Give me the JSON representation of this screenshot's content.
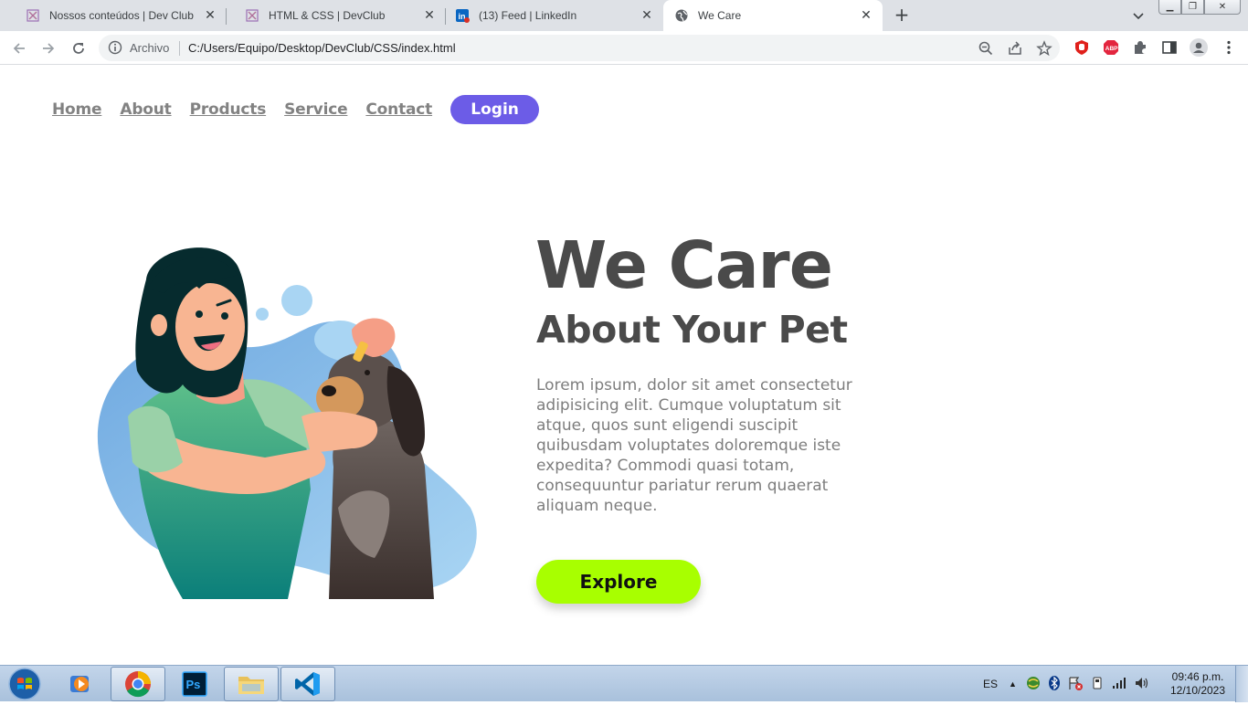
{
  "browser": {
    "tabs": [
      {
        "title": "Nossos conteúdos | Dev Club",
        "icon": "devclub-favicon",
        "active": false
      },
      {
        "title": "HTML & CSS | DevClub",
        "icon": "devclub-favicon",
        "active": false
      },
      {
        "title": "(13) Feed | LinkedIn",
        "icon": "linkedin-favicon",
        "active": false
      },
      {
        "title": "We Care",
        "icon": "globe-favicon",
        "active": true
      }
    ],
    "address": {
      "scheme_label": "Archivo",
      "url": "C:/Users/Equipo/Desktop/DevClub/CSS/index.html"
    }
  },
  "page": {
    "nav": {
      "links": [
        "Home",
        "About",
        "Products",
        "Service",
        "Contact"
      ],
      "login_label": "Login"
    },
    "hero": {
      "title": "We Care",
      "subtitle": "About Your Pet",
      "description": "Lorem ipsum, dolor sit amet consectetur adipisicing elit. Cumque voluptatum sit atque, quos sunt eligendi suscipit quibusdam voluptates doloremque iste expedita? Commodi quasi totam, consequuntur pariatur rerum quaerat aliquam neque.",
      "button_label": "Explore"
    },
    "colors": {
      "accent_purple": "#6c5ce7",
      "accent_lime": "#a8ff00",
      "heading": "#4a4a4a",
      "body_text": "#7d7d7d",
      "nav_text": "#828282"
    }
  },
  "taskbar": {
    "apps": [
      "media-player",
      "chrome",
      "photoshop",
      "file-explorer",
      "vscode"
    ],
    "language": "ES",
    "time": "09:46 p.m.",
    "date": "12/10/2023"
  }
}
